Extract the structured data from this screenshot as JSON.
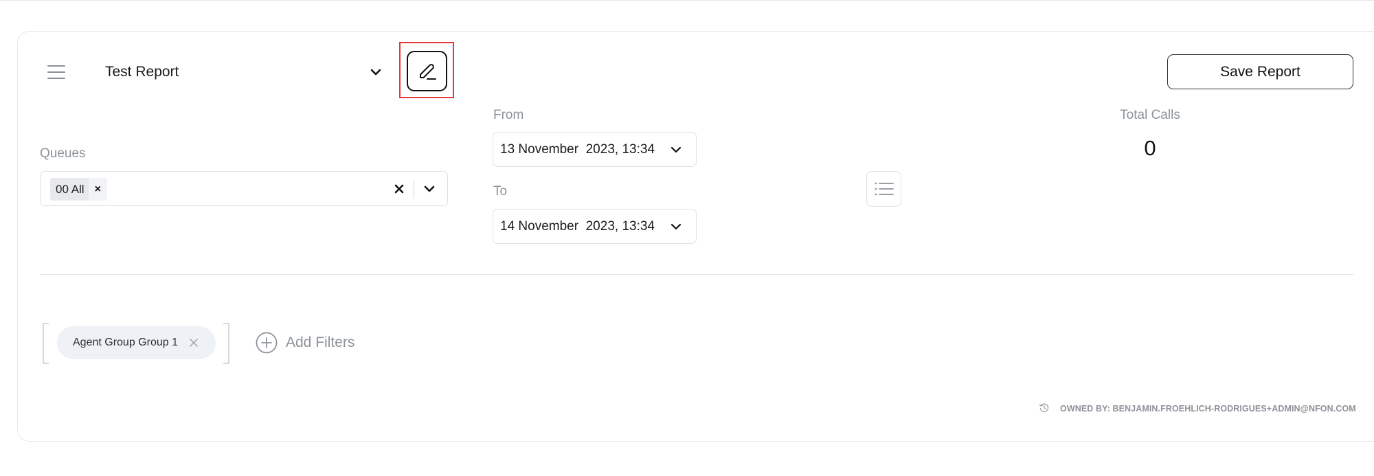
{
  "header": {
    "report_name": "Test Report",
    "save_label": "Save Report"
  },
  "queues": {
    "label": "Queues",
    "selected_chip": "00 All"
  },
  "dates": {
    "from_label": "From",
    "from_value": "13 November  2023, 13:34",
    "to_label": "To",
    "to_value": "14 November  2023, 13:34"
  },
  "stats": {
    "total_calls_label": "Total Calls",
    "total_calls_value": "0"
  },
  "filters": {
    "active": [
      {
        "label": "Agent Group Group 1"
      }
    ],
    "add_label": "Add Filters"
  },
  "footer": {
    "owner_text": "OWNED BY: BENJAMIN.FROEHLICH-RODRIGUES+ADMIN@NFON.COM"
  },
  "icons": {
    "menu": "hamburger-menu-icon",
    "dropdown": "chevron-down-icon",
    "edit": "pencil-icon",
    "clear": "close-icon",
    "list": "list-icon",
    "add": "plus-circle-icon",
    "history": "history-icon"
  },
  "colors": {
    "highlight": "#e53935",
    "muted_text": "#8d9299",
    "chip_bg": "#eef1f5",
    "border": "#dfe2e6"
  }
}
